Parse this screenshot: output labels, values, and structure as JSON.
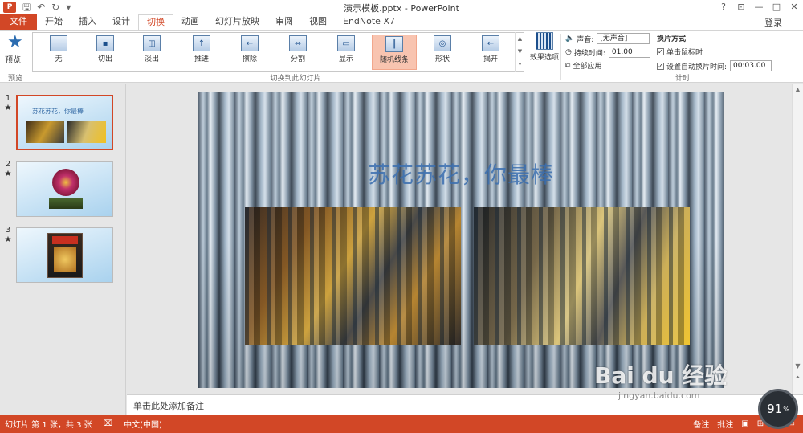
{
  "app": {
    "title": "演示模板.pptx - PowerPoint",
    "login": "登录"
  },
  "quick_access": {
    "logo": "P",
    "icons": [
      "save-icon",
      "undo-icon",
      "redo-icon",
      "customize-icon"
    ]
  },
  "window_controls": [
    "?",
    "restore-ribbon",
    "_",
    "□",
    "×"
  ],
  "tabs": [
    "文件",
    "开始",
    "插入",
    "设计",
    "切换",
    "动画",
    "幻灯片放映",
    "审阅",
    "视图",
    "EndNote X7"
  ],
  "active_tab": "切换",
  "ribbon": {
    "preview": {
      "label": "预览",
      "group": "预览"
    },
    "transitions_group": "切换到此幻灯片",
    "transitions": [
      {
        "label": "无",
        "glyph": ""
      },
      {
        "label": "切出",
        "glyph": "▪"
      },
      {
        "label": "淡出",
        "glyph": "◫"
      },
      {
        "label": "推进",
        "glyph": "↑"
      },
      {
        "label": "擦除",
        "glyph": "←"
      },
      {
        "label": "分割",
        "glyph": "⇔"
      },
      {
        "label": "显示",
        "glyph": "▭"
      },
      {
        "label": "随机线条",
        "glyph": "║"
      },
      {
        "label": "形状",
        "glyph": "◎"
      },
      {
        "label": "揭开",
        "glyph": "←"
      }
    ],
    "selected_transition": "随机线条",
    "effect_options": "效果选项",
    "timing": {
      "group": "计时",
      "sound_label": "声音:",
      "sound_value": "[无声音]",
      "duration_label": "持续时间:",
      "duration_value": "01.00",
      "apply_all": "全部应用",
      "advance_label": "换片方式",
      "on_click_label": "单击鼠标时",
      "on_click_checked": "✓",
      "after_label": "设置自动换片时间:",
      "after_checked": "✓",
      "after_value": "00:03.00"
    }
  },
  "slides": [
    {
      "num": "1",
      "star": "★",
      "title": "苏花苏花，你最棒"
    },
    {
      "num": "2",
      "star": "★"
    },
    {
      "num": "3",
      "star": "★"
    }
  ],
  "main_slide": {
    "title": "苏花苏花，你最棒"
  },
  "notes_placeholder": "单击此处添加备注",
  "status": {
    "slide_info": "幻灯片 第 1 张，共 3 张",
    "language": "中文(中国)",
    "notes": "备注",
    "comments": "批注"
  },
  "watermark": {
    "text": "Bai du 经验",
    "sub": "jingyan.baidu.com"
  },
  "overlay": {
    "speed_value": "91",
    "speed_unit": "%"
  }
}
